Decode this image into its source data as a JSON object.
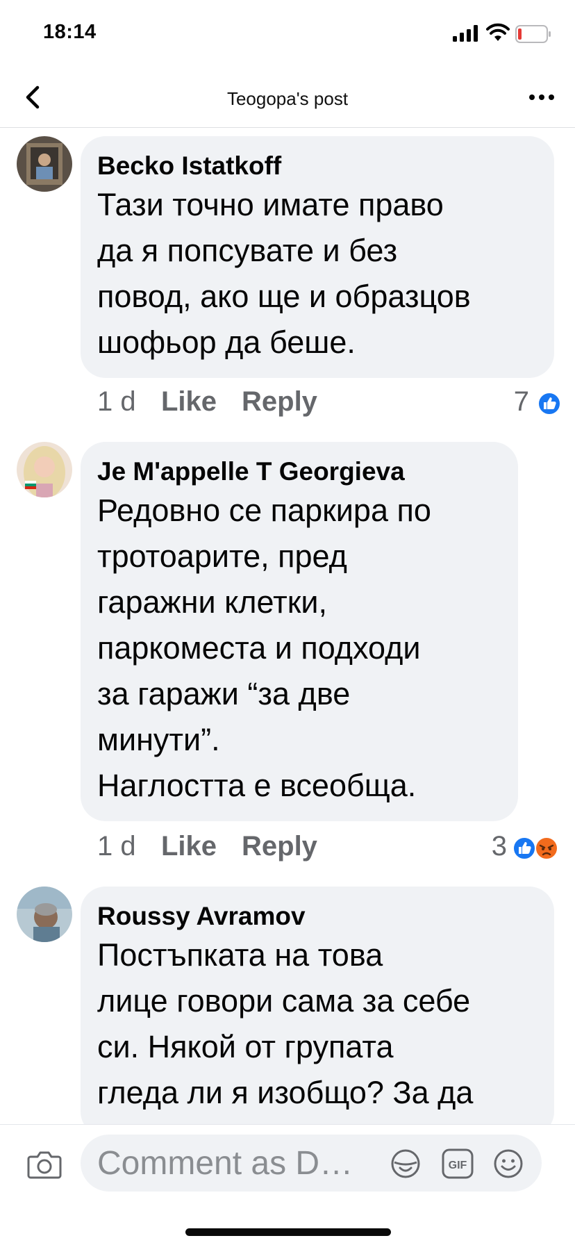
{
  "status_bar": {
    "time": "18:14"
  },
  "header": {
    "title": "Teogopa's post"
  },
  "comments": [
    {
      "author": "Becko Istatkoff",
      "text": "Тази точно имате право\nда я попсувате и без\nповод, ако ще и образцов\nшофьор да беше.",
      "time": "1 d",
      "like_label": "Like",
      "reply_label": "Reply",
      "reaction_count": "7",
      "reactions": [
        "like-icon"
      ]
    },
    {
      "author": "Je M'appelle T Georgieva",
      "text": "Редовно се паркира по\nтротоарите, пред\nгаражни клетки,\nпаркоместа и подходи\nза гаражи “за две\nминути”.\nНаглостта е всеобща.",
      "time": "1 d",
      "like_label": "Like",
      "reply_label": "Reply",
      "reaction_count": "3",
      "reactions": [
        "like-icon",
        "angry-icon"
      ]
    },
    {
      "author": "Roussy Avramov",
      "text": "Постъпката на това\nлице говори сама за себе\nси. Някой от групата\nгледа ли я изобщо? За да",
      "time": "",
      "like_label": "",
      "reply_label": ""
    }
  ],
  "composer": {
    "placeholder": "Comment as D…",
    "icons": [
      "camera-icon",
      "sticker-icon",
      "gif-icon",
      "emoji-icon"
    ],
    "gif_label": "GIF"
  },
  "colors": {
    "bubble": "#f0f2f5",
    "meta_text": "#65676b",
    "like_blue": "#1877f2",
    "angry_orange": "#f26b1d"
  }
}
